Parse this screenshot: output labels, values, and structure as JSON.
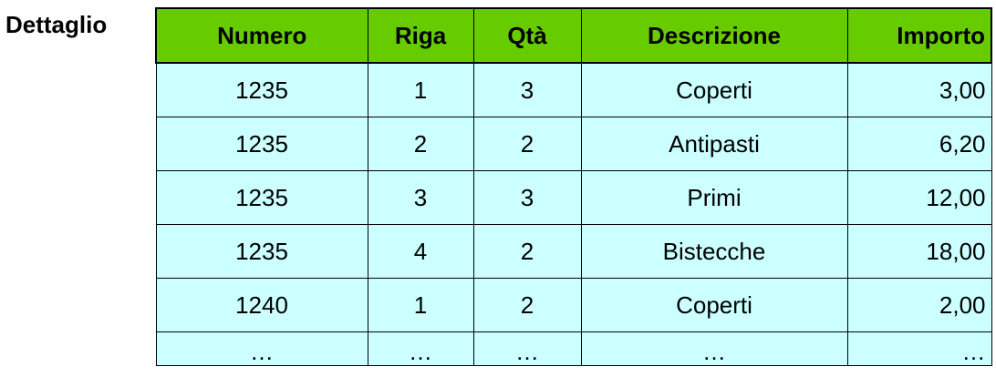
{
  "title": "Dettaglio",
  "table": {
    "headers": [
      "Numero",
      "Riga",
      "Qtà",
      "Descrizione",
      "Importo"
    ],
    "rows": [
      [
        "1235",
        "1",
        "3",
        "Coperti",
        "3,00"
      ],
      [
        "1235",
        "2",
        "2",
        "Antipasti",
        "6,20"
      ],
      [
        "1235",
        "3",
        "3",
        "Primi",
        "12,00"
      ],
      [
        "1235",
        "4",
        "2",
        "Bistecche",
        "18,00"
      ],
      [
        "1240",
        "1",
        "2",
        "Coperti",
        "2,00"
      ],
      [
        "…",
        "…",
        "…",
        "…",
        "…"
      ]
    ]
  },
  "colors": {
    "header_bg": "#66cc00",
    "row_bg": "#ccffff"
  }
}
